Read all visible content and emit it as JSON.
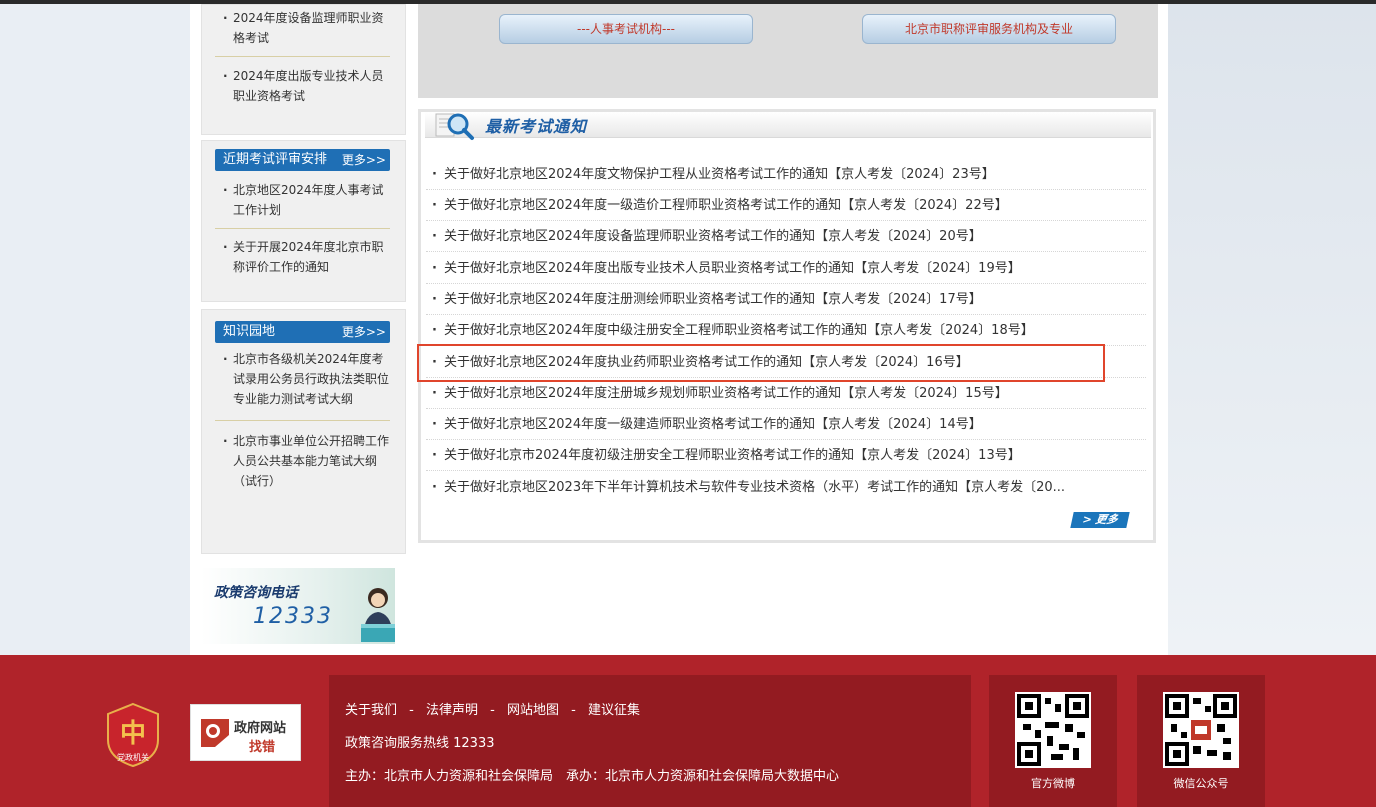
{
  "sidebar": {
    "top_items": [
      "2024年度设备监理师职业资格考试",
      "2024年度出版专业技术人员职业资格考试"
    ],
    "exam_schedule": {
      "title": "近期考试评审安排",
      "more": "更多>>",
      "items": [
        "北京地区2024年度人事考试工作计划",
        "关于开展2024年度北京市职称评价工作的通知"
      ]
    },
    "knowledge": {
      "title": "知识园地",
      "more": "更多>>",
      "items": [
        "北京市各级机关2024年度考试录用公务员行政执法类职位专业能力测试考试大纲",
        "北京市事业单位公开招聘工作人员公共基本能力笔试大纲（试行）"
      ]
    },
    "hotline": {
      "title": "政策咨询电话",
      "number": "12333"
    }
  },
  "top_buttons": {
    "left": "---人事考试机构---",
    "right": "北京市职称评审服务机构及专业"
  },
  "news": {
    "title": "最新考试通知",
    "items": [
      "关于做好北京地区2024年度文物保护工程从业资格考试工作的通知【京人考发〔2024〕23号】",
      "关于做好北京地区2024年度一级造价工程师职业资格考试工作的通知【京人考发〔2024〕22号】",
      "关于做好北京地区2024年度设备监理师职业资格考试工作的通知【京人考发〔2024〕20号】",
      "关于做好北京地区2024年度出版专业技术人员职业资格考试工作的通知【京人考发〔2024〕19号】",
      "关于做好北京地区2024年度注册测绘师职业资格考试工作的通知【京人考发〔2024〕17号】",
      "关于做好北京地区2024年度中级注册安全工程师职业资格考试工作的通知【京人考发〔2024〕18号】",
      "关于做好北京地区2024年度执业药师职业资格考试工作的通知【京人考发〔2024〕16号】",
      "关于做好北京地区2024年度注册城乡规划师职业资格考试工作的通知【京人考发〔2024〕15号】",
      "关于做好北京地区2024年度一级建造师职业资格考试工作的通知【京人考发〔2024〕14号】",
      "关于做好北京市2024年度初级注册安全工程师职业资格考试工作的通知【京人考发〔2024〕13号】",
      "关于做好北京地区2023年下半年计算机技术与软件专业技术资格（水平）考试工作的通知【京人考发〔20..."
    ],
    "more": "> 更多",
    "highlight_color": "#e0452c"
  },
  "footer": {
    "logo1_text": "党政机关",
    "logo2_line1": "政府网站",
    "logo2_line2": "找错",
    "links": [
      "关于我们",
      "法律声明",
      "网站地图",
      "建议征集"
    ],
    "separator": "-",
    "hotline": "政策咨询服务热线 12333",
    "host": "主办：北京市人力资源和社会保障局　承办：北京市人力资源和社会保障局大数据中心",
    "qr1_label": "官方微博",
    "qr2_label": "微信公众号"
  },
  "colors": {
    "footer_red": "#b0232a",
    "sidebar_header_blue": "#1f6fb5",
    "title_blue": "#1f5fa5"
  }
}
